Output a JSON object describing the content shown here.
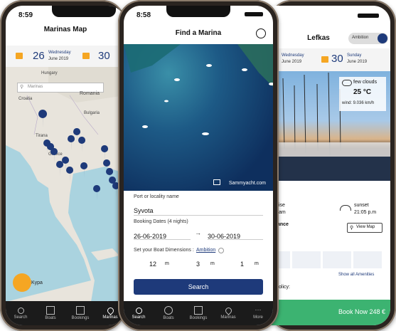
{
  "left_phone": {
    "time": "8:59",
    "title": "Marinas Map",
    "date1_day": "26",
    "date1_weekday": "Wednesday",
    "date1_month": "June 2019",
    "date2_day": "30",
    "search_placeholder": "Marinas",
    "map_labels": [
      "Hungary",
      "Romania",
      "Croatia",
      "Bulgaria",
      "Tirana",
      "Greece",
      "Kypa"
    ],
    "tabs": [
      "Search",
      "Boats",
      "Bookings",
      "Marinas"
    ]
  },
  "middle_phone": {
    "time": "8:58",
    "title": "Find a Marina",
    "watermark": "Sammyacht.com",
    "port_label": "Port or locality name",
    "port_value": "Syvota",
    "booking_label": "Booking Dates (4 nights)",
    "date_from": "26-06-2019",
    "date_arrow": "→",
    "date_to": "30-06-2019",
    "dims_label": "Set your Boat Dimensions :",
    "dims_link": "Ambition",
    "dims": [
      {
        "value": "12",
        "unit": "m"
      },
      {
        "value": "3",
        "unit": "m"
      },
      {
        "value": "1",
        "unit": "m"
      }
    ],
    "search_button": "Search",
    "tabs": [
      "Search",
      "Boats",
      "Bookings",
      "Marinas",
      "More"
    ]
  },
  "right_phone": {
    "title": "Lefkas",
    "toggle_label": "Ambition",
    "date1_weekday": "Wednesday",
    "date1_month": "June 2019",
    "date2_day": "30",
    "date2_weekday": "Sunday",
    "date2_month": "June 2019",
    "weather_desc": "few clouds",
    "weather_temp": "25 °C",
    "weather_wind": "wind: 9.036 km/h",
    "sunrise_label": "ise",
    "sunrise_time": "am",
    "sunset_label": "sunset",
    "sunset_time": "21:05 p.m",
    "distance_label": "ance",
    "view_map": "View Map",
    "show_all": "Show all Amenities",
    "policy_label": "olicy:",
    "book_now": "Book Now 248 €"
  },
  "colors": {
    "brand_blue": "#1e3a7a",
    "accent_orange": "#f5a623",
    "book_green": "#3cb371"
  }
}
